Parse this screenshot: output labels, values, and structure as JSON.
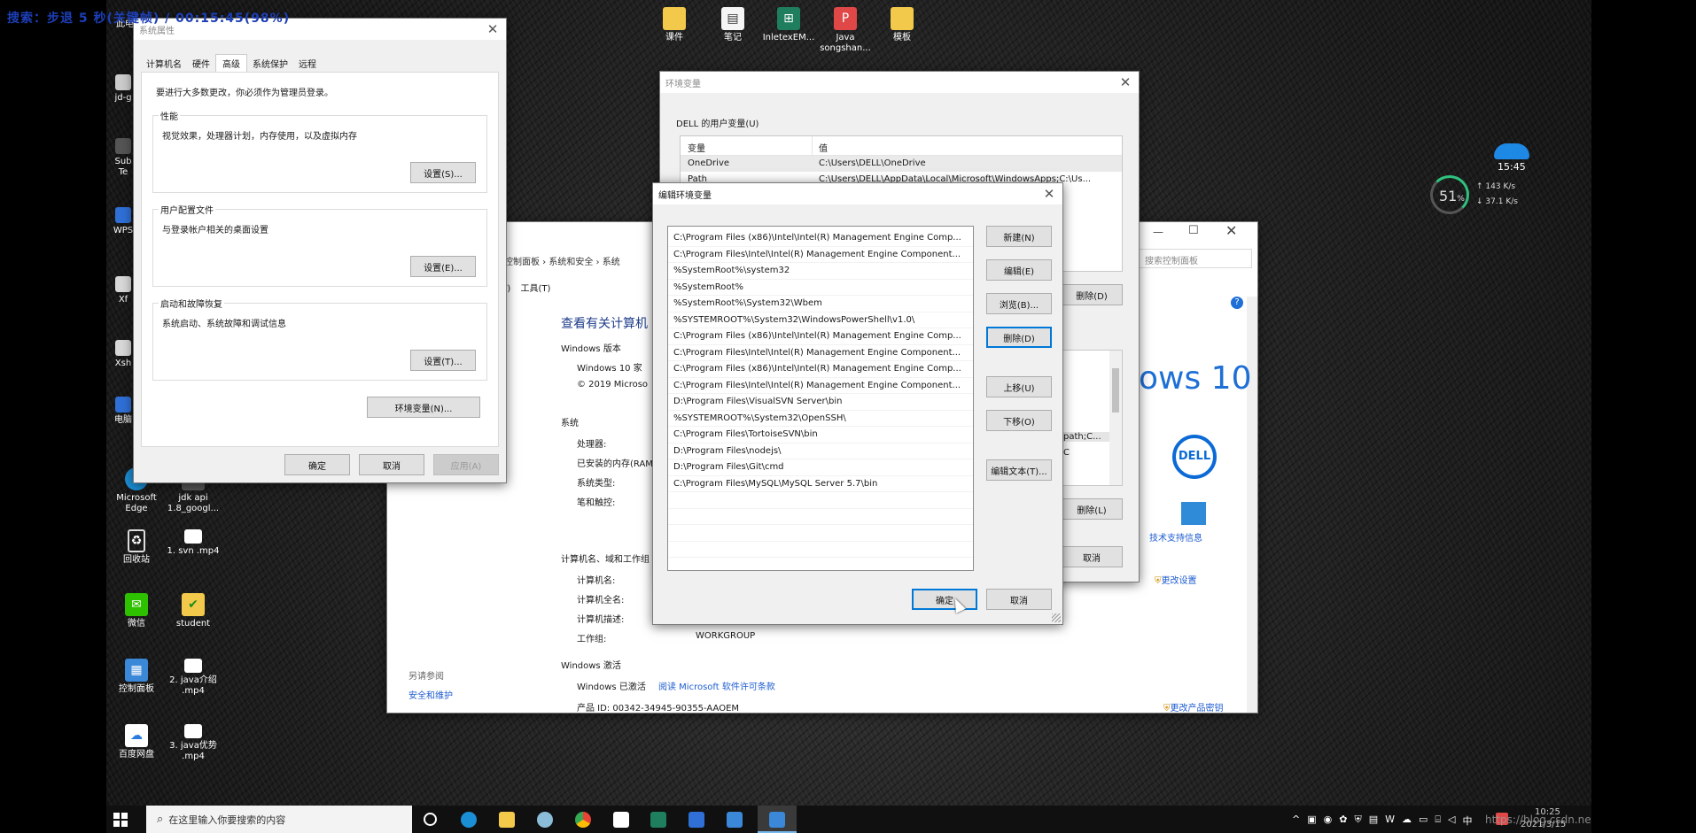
{
  "overlay": {
    "recorder": "搜索：步退 5 秒(关键帧) / 00:15:45(98%)"
  },
  "desktop_icons": [
    {
      "label": "课件",
      "icon": "folder-icon"
    },
    {
      "label": "笔记",
      "icon": "document-icon"
    },
    {
      "label": "InletexEM...",
      "icon": "app-icon"
    },
    {
      "label": "Java songshan...",
      "icon": "pdf-icon"
    },
    {
      "label": "模板",
      "icon": "folder-icon"
    },
    {
      "label": "此电",
      "icon": "computer-icon"
    },
    {
      "label": "jd-g",
      "icon": "app-icon"
    },
    {
      "label": "Sub Te",
      "icon": "app-icon"
    },
    {
      "label": "WPS",
      "icon": "wps-icon"
    },
    {
      "label": "Xf",
      "icon": "app-icon"
    },
    {
      "label": "Xsh",
      "icon": "app-icon"
    },
    {
      "label": "电脑",
      "icon": "app-icon"
    },
    {
      "label": "Microsoft Edge",
      "icon": "edge-icon"
    },
    {
      "label": "jdk api 1.8_googl...",
      "icon": "document-icon"
    },
    {
      "label": "回收站",
      "icon": "recycle-bin-icon"
    },
    {
      "label": "1. svn .mp4",
      "icon": "video-icon"
    },
    {
      "label": "微信",
      "icon": "wechat-icon"
    },
    {
      "label": "student",
      "icon": "student-icon"
    },
    {
      "label": "控制面板",
      "icon": "control-panel-icon"
    },
    {
      "label": "2. java介绍 .mp4",
      "icon": "video-icon"
    },
    {
      "label": "百度网盘",
      "icon": "baidu-icon"
    },
    {
      "label": "3. java优势 .mp4",
      "icon": "video-icon"
    }
  ],
  "widget": {
    "time": "15:45",
    "cpu": "51",
    "unit": "%",
    "up": "143",
    "up_unit": "K/s",
    "down": "37.1",
    "down_unit": "K/s"
  },
  "sysprops": {
    "title": "系统属性",
    "tabs": [
      "计算机名",
      "硬件",
      "高级",
      "系统保护",
      "远程"
    ],
    "note": "要进行大多数更改，你必须作为管理员登录。",
    "perf": {
      "label": "性能",
      "desc": "视觉效果，处理器计划，内存使用，以及虚拟内存",
      "button": "设置(S)..."
    },
    "profile": {
      "label": "用户配置文件",
      "desc": "与登录帐户相关的桌面设置",
      "button": "设置(E)..."
    },
    "startup": {
      "label": "启动和故障恢复",
      "desc": "系统启动、系统故障和调试信息",
      "button": "设置(T)..."
    },
    "envbtn": "环境变量(N)...",
    "ok": "确定",
    "cancel": "取消",
    "apply": "应用(A)"
  },
  "envvars": {
    "title": "环境变量",
    "user_label": "DELL 的用户变量(U)",
    "col_var": "变量",
    "col_val": "值",
    "rows": [
      {
        "var": "OneDrive",
        "val": "C:\\Users\\DELL\\OneDrive"
      },
      {
        "var": "Path",
        "val": "C:\\Users\\DELL\\AppData\\Local\\Microsoft\\WindowsApps;C:\\Us..."
      }
    ],
    "delete1": "删除(D)",
    "sys_row": "path;C...",
    "sys_row2": "C",
    "delete2": "删除(L)",
    "cancel": "取消"
  },
  "controlpanel": {
    "breadcrumb": [
      "控制面板",
      "系统和安全",
      "系统"
    ],
    "search_placeholder": "搜索控制面板",
    "menu": [
      "/)",
      "工具(T)"
    ],
    "heading": "查看有关计算机",
    "win_edition": "Windows 版本",
    "win_name": "Windows 10 家",
    "copyright": "© 2019 Microso",
    "win10": "ows 10",
    "system": "系统",
    "processor": "处理器:",
    "ram": "已安装的内存(RAM",
    "systype": "系统类型:",
    "pen": "笔和触控:",
    "dell": "DELL",
    "support": "技术支持信息",
    "compname_section": "计算机名、域和工作组",
    "compname": "计算机名:",
    "fullname": "计算机全名:",
    "desc": "计算机描述:",
    "workgroup_label": "工作组:",
    "workgroup": "WORKGROUP",
    "change": "更改设置",
    "activation": "Windows 激活",
    "activated": "Windows 已激活",
    "license": "阅读 Microsoft 软件许可条款",
    "product": "产品 ID: 00342-34945-90355-AAOEM",
    "change_key": "更改产品密钥",
    "see_also": "另请参阅",
    "security": "安全和维护"
  },
  "editenv": {
    "title": "编辑环境变量",
    "paths": [
      "C:\\Program Files (x86)\\Intel\\Intel(R) Management Engine Comp...",
      "C:\\Program Files\\Intel\\Intel(R) Management Engine Component...",
      "%SystemRoot%\\system32",
      "%SystemRoot%",
      "%SystemRoot%\\System32\\Wbem",
      "%SYSTEMROOT%\\System32\\WindowsPowerShell\\v1.0\\",
      "C:\\Program Files (x86)\\Intel\\Intel(R) Management Engine Comp...",
      "C:\\Program Files\\Intel\\Intel(R) Management Engine Component...",
      "C:\\Program Files (x86)\\Intel\\Intel(R) Management Engine Comp...",
      "C:\\Program Files\\Intel\\Intel(R) Management Engine Component...",
      "D:\\Program Files\\VisualSVN Server\\bin",
      "%SYSTEMROOT%\\System32\\OpenSSH\\",
      "C:\\Program Files\\TortoiseSVN\\bin",
      "D:\\Program Files\\nodejs\\",
      "D:\\Program Files\\Git\\cmd",
      "C:\\Program Files\\MySQL\\MySQL Server 5.7\\bin"
    ],
    "new": "新建(N)",
    "edit": "编辑(E)",
    "browse": "浏览(B)...",
    "delete": "删除(D)",
    "up": "上移(U)",
    "down": "下移(O)",
    "edittext": "编辑文本(T)...",
    "ok": "确定",
    "cancel": "取消"
  },
  "taskbar": {
    "search_placeholder": "在这里输入你要搜索的内容",
    "time": "10:25",
    "date": "2021/3/15",
    "watermark": "https://blog.csdn.ne",
    "ime": "中"
  }
}
